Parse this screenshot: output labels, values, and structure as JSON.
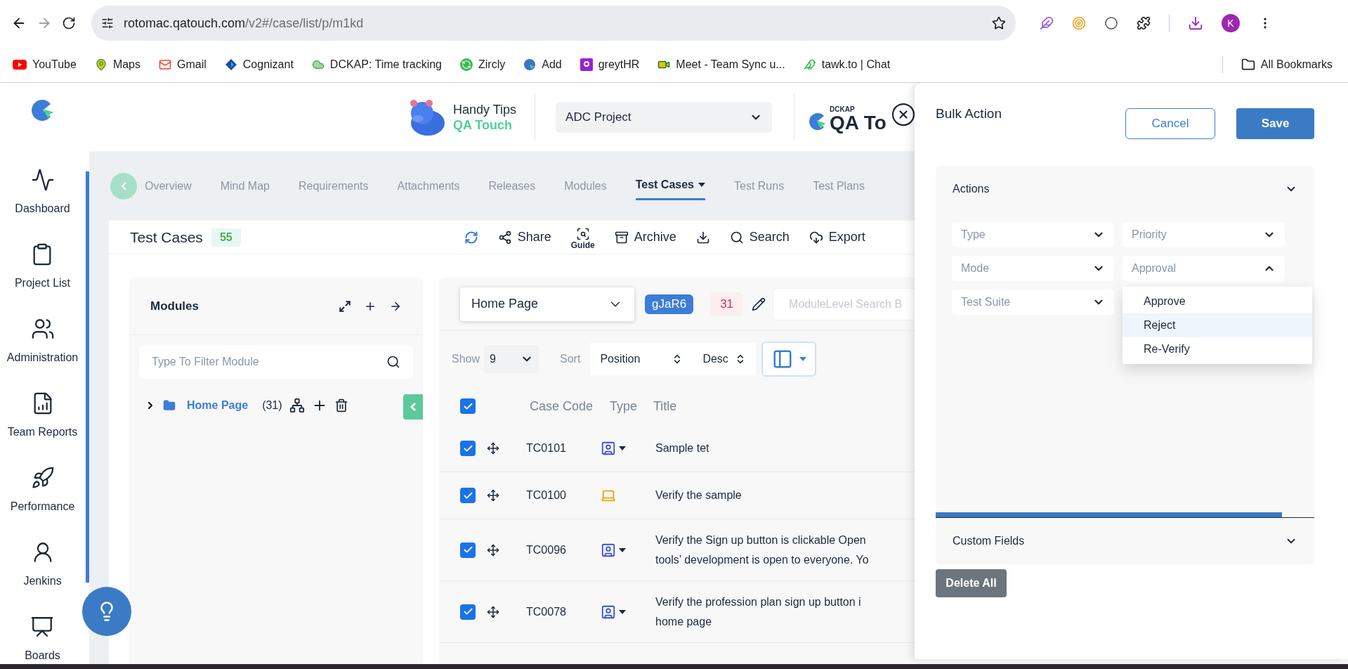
{
  "browser": {
    "url_host": "rotomac.qatouch.com",
    "url_path": "/v2#/case/list/p/m1kd",
    "profile": "K",
    "bookmarks": [
      {
        "label": "YouTube",
        "kind": "youtube"
      },
      {
        "label": "Maps",
        "kind": "maps"
      },
      {
        "label": "Gmail",
        "kind": "gmail"
      },
      {
        "label": "Cognizant",
        "kind": "cognizant"
      },
      {
        "label": "DCKAP: Time tracking",
        "kind": "cloud"
      },
      {
        "label": "Zircly",
        "kind": "zircly"
      },
      {
        "label": "Add",
        "kind": "add"
      },
      {
        "label": "greytHR",
        "kind": "greyt"
      },
      {
        "label": "Meet - Team Sync u...",
        "kind": "meet"
      },
      {
        "label": "tawk.to | Chat",
        "kind": "tawk"
      }
    ],
    "all_bookmarks": "All Bookmarks"
  },
  "sidebar": {
    "items": [
      {
        "label": "Dashboard",
        "kind": "dashboard"
      },
      {
        "label": "Project List",
        "kind": "projects"
      },
      {
        "label": "Administration",
        "kind": "admin"
      },
      {
        "label": "Team Reports",
        "kind": "reports"
      },
      {
        "label": "Performance",
        "kind": "performance"
      },
      {
        "label": "Jenkins",
        "kind": "jenkins"
      },
      {
        "label": "Boards",
        "kind": "boards"
      }
    ]
  },
  "header": {
    "tips_title": "Handy Tips",
    "tips_brand": "QA Touch",
    "project": "ADC Project",
    "logo_small": "DCKAP",
    "logo_big": "QA To"
  },
  "tabs": [
    {
      "label": "Overview",
      "selected": false,
      "menu": false
    },
    {
      "label": "Mind Map",
      "selected": false,
      "menu": false
    },
    {
      "label": "Requirements",
      "selected": false,
      "menu": false
    },
    {
      "label": "Attachments",
      "selected": false,
      "menu": false
    },
    {
      "label": "Releases",
      "selected": false,
      "menu": false
    },
    {
      "label": "Modules",
      "selected": false,
      "menu": false
    },
    {
      "label": "Test Cases",
      "selected": true,
      "menu": true
    },
    {
      "label": "Test Runs",
      "selected": false,
      "menu": false
    },
    {
      "label": "Test Plans",
      "selected": false,
      "menu": false
    }
  ],
  "page": {
    "title": "Test Cases",
    "count": "55",
    "toolbar": [
      {
        "kind": "refresh"
      },
      {
        "kind": "share",
        "label": "Share"
      },
      {
        "kind": "guide",
        "label": "Guide"
      },
      {
        "kind": "archive",
        "label": "Archive"
      },
      {
        "kind": "import"
      },
      {
        "kind": "search",
        "label": "Search"
      },
      {
        "kind": "export",
        "label": "Export"
      }
    ]
  },
  "modules": {
    "title": "Modules",
    "filter_placeholder": "Type To Filter Module",
    "tree": [
      {
        "label": "Home Page",
        "count": "(31)",
        "expanded": false
      }
    ]
  },
  "cases": {
    "module": "Home Page",
    "code": "gJaR6",
    "count": "31",
    "search_placeholder": "ModuleLevel Search B",
    "show_label": "Show",
    "show_value": "9",
    "sort_label": "Sort",
    "sort_field": "Position",
    "sort_order": "Desc",
    "all_checked": true,
    "columns": [
      "Case Code",
      "Type",
      "Title"
    ],
    "rows": [
      {
        "checked": true,
        "code": "TC0101",
        "kind": "manual",
        "title": [
          "Sample tet"
        ]
      },
      {
        "checked": true,
        "code": "TC0100",
        "kind": "automated",
        "title": [
          "Verify the sample"
        ]
      },
      {
        "checked": true,
        "code": "TC0096",
        "kind": "manual",
        "title": [
          "Verify the Sign up button is clickable Open",
          "tools’ development is open to everyone. Yo"
        ]
      },
      {
        "checked": true,
        "code": "TC0078",
        "kind": "manual",
        "title": [
          "Verify the profession plan sign up button i",
          "home page"
        ]
      }
    ]
  },
  "bulk_action": {
    "title": "Bulk Action",
    "cancel": "Cancel",
    "save": "Save",
    "sections": [
      {
        "title": "Actions",
        "expanded": true,
        "fields": [
          {
            "label": "Type",
            "open": false
          },
          {
            "label": "Priority",
            "open": false
          },
          {
            "label": "Mode",
            "open": false
          },
          {
            "label": "Approval",
            "open": true,
            "options": [
              {
                "label": "Approve",
                "selected": false
              },
              {
                "label": "Reject",
                "selected": true
              },
              {
                "label": "Re-Verify",
                "selected": false
              }
            ]
          },
          {
            "label": "Test Suite",
            "open": false
          }
        ]
      },
      {
        "title": "Custom Fields",
        "expanded": false
      }
    ],
    "delete_all": "Delete All"
  }
}
